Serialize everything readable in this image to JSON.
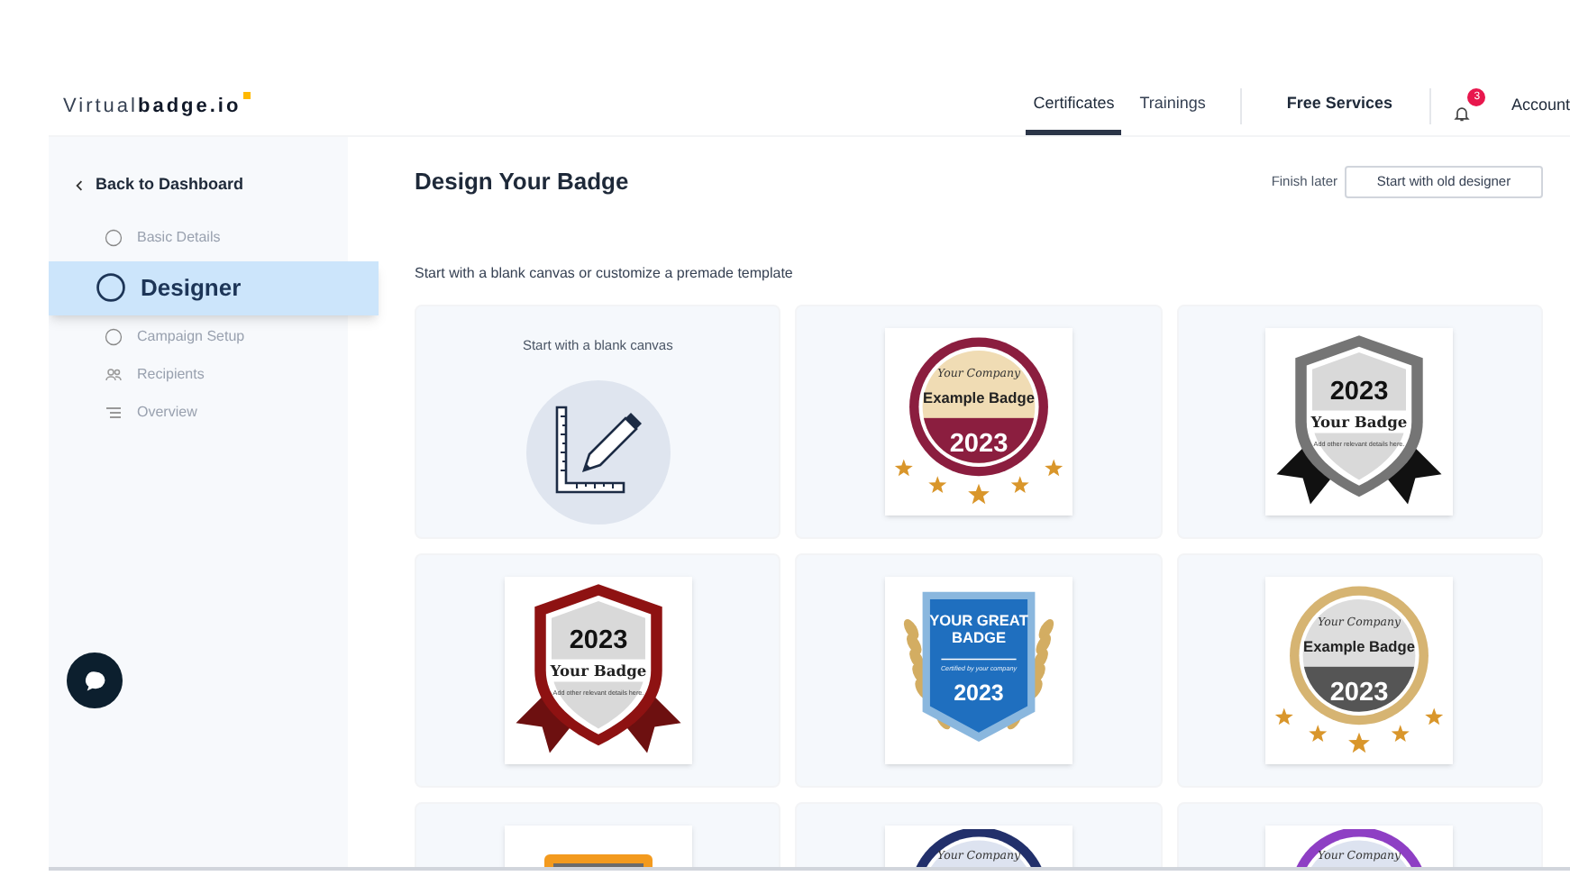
{
  "header": {
    "logo_light": "Virtual",
    "logo_bold": "badge.io",
    "nav": [
      {
        "label": "Certificates",
        "selected": true
      },
      {
        "label": "Trainings",
        "selected": false
      },
      {
        "label": "Free Services",
        "selected": false
      }
    ],
    "notifications": "3",
    "account": "Account"
  },
  "sidebar": {
    "back": "Back to Dashboard",
    "steps": [
      {
        "label": "Basic Details",
        "kind": "circle",
        "selected": false
      },
      {
        "label": "Designer",
        "kind": "circle",
        "selected": true
      },
      {
        "label": "Campaign Setup",
        "kind": "circle",
        "selected": false
      },
      {
        "label": "Recipients",
        "kind": "people",
        "selected": false
      },
      {
        "label": "Overview",
        "kind": "list",
        "selected": false
      }
    ]
  },
  "main": {
    "title": "Design Your Badge",
    "finish_later": "Finish later",
    "old_designer": "Start with old designer",
    "subtitle": "Start with a blank canvas or customize a premade template",
    "blank_canvas": "Start with a blank canvas",
    "templates": [
      {
        "kind": "round",
        "color": "#8b1e3f",
        "script": "Your Company",
        "title": "Example Badge",
        "year": "2023"
      },
      {
        "kind": "shield",
        "color": "#757575",
        "year": "2023",
        "title": "Your Badge",
        "note": "Add other relevant details here."
      },
      {
        "kind": "shield",
        "color": "#8e1212",
        "year": "2023",
        "title": "Your Badge",
        "note": "Add other relevant details here."
      },
      {
        "kind": "pennant",
        "color": "#1f6fbf",
        "title_lines": [
          "YOUR GREAT",
          "BADGE"
        ],
        "note": "Certified by your company",
        "year": "2023"
      },
      {
        "kind": "round",
        "color": "#d6b472",
        "script": "Your Company",
        "title": "Example Badge",
        "year": "2023"
      },
      {
        "kind": "banner",
        "color": "#f39a1e"
      },
      {
        "kind": "round",
        "color": "#22306b",
        "script": "Your Company"
      },
      {
        "kind": "round",
        "color": "#8e3fc4",
        "script": "Your Company"
      }
    ]
  }
}
